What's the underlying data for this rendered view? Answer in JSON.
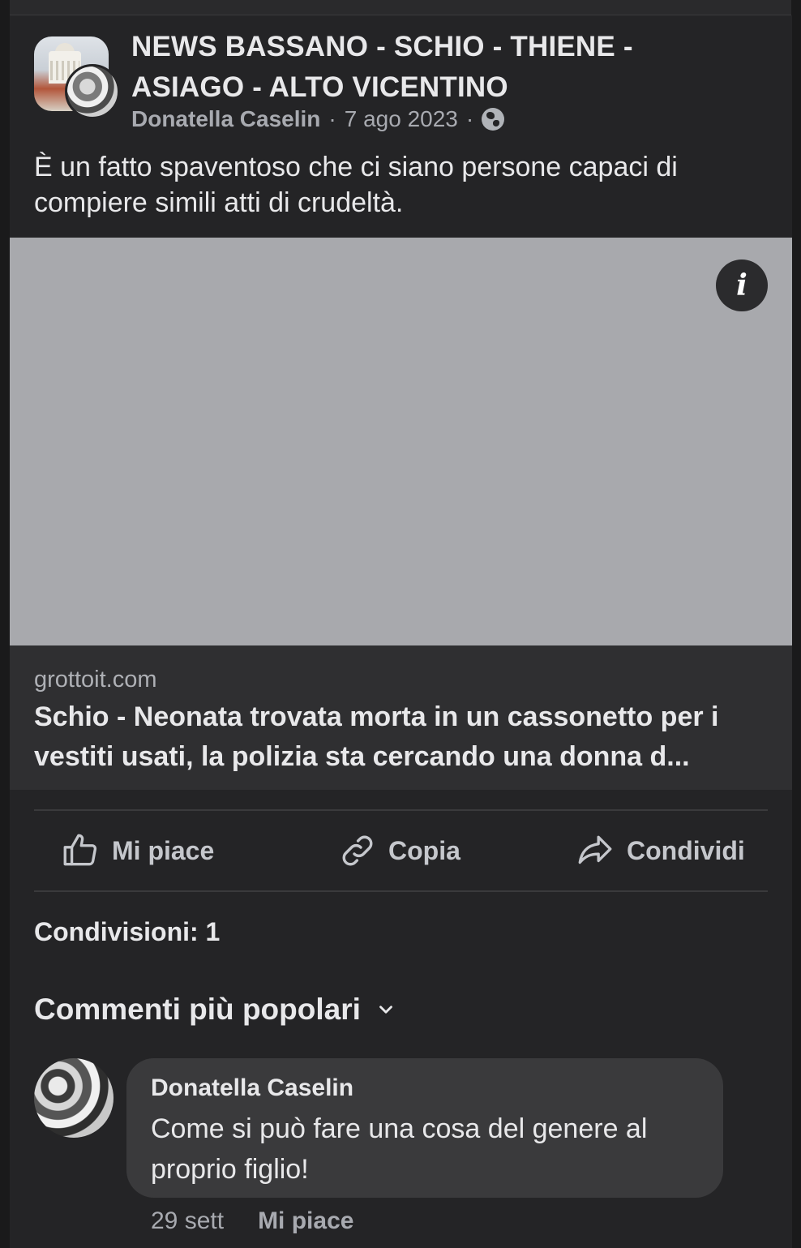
{
  "post": {
    "group_name": "NEWS BASSANO - SCHIO - THIENE - ASIAGO - ALTO VICENTINO",
    "author": "Donatella Caselin",
    "date": "7 ago 2023",
    "separator": "·",
    "privacy_icon": "globe-icon",
    "text": "È un fatto spaventoso che ci siano persone capaci di compiere simili atti di crudeltà."
  },
  "link": {
    "domain": "grottoit.com",
    "title": "Schio - Neonata trovata morta in un cassonetto per i vestiti usati, la polizia sta cercando una donna d...",
    "info_icon": "i"
  },
  "actions": {
    "like": "Mi piace",
    "copy": "Copia",
    "share": "Condividi"
  },
  "shares_label": "Condivisioni: 1",
  "comments": {
    "sort_label": "Commenti più popolari",
    "items": [
      {
        "author": "Donatella Caselin",
        "text": "Come si può fare una cosa del genere al proprio figlio!",
        "time": "29 sett",
        "like": "Mi piace"
      }
    ]
  },
  "colors": {
    "background": "#1a1a1b",
    "card": "#242426",
    "media_placeholder": "#a8a9ad",
    "comment_bubble": "#3a3a3c"
  }
}
